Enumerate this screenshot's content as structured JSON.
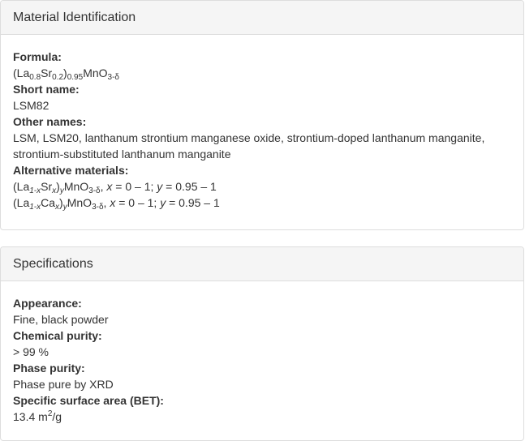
{
  "identification": {
    "heading": "Material Identification",
    "formula_label": "Formula:",
    "formula": {
      "p1": "(La",
      "s1": "0.8",
      "p2": "Sr",
      "s2": "0.2",
      "p3": ")",
      "s3": "0.95",
      "p4": "MnO",
      "s4": "3-δ"
    },
    "short_name_label": "Short name:",
    "short_name": "LSM82",
    "other_names_label": "Other names:",
    "other_names": "LSM, LSM20, lanthanum strontium manganese oxide, strontium-doped lanthanum manganite, strontium-substituted lanthanum manganite",
    "alternatives_label": "Alternative materials:",
    "alt1": {
      "p1": "(La",
      "s1": "1-x",
      "p2": "Sr",
      "s2": "x",
      "p3": ")",
      "s3": "y",
      "p4": "MnO",
      "s4": "3-δ",
      "tail_a": ", ",
      "xvar": "x",
      "tail_b": " = 0 – 1; ",
      "yvar": "y",
      "tail_c": " = 0.95 – 1"
    },
    "alt2": {
      "p1": "(La",
      "s1": "1-x",
      "p2": "Ca",
      "s2": "x",
      "p3": ")",
      "s3": "y",
      "p4": "MnO",
      "s4": "3-δ",
      "tail_a": ", ",
      "xvar": "x",
      "tail_b": " = 0 – 1; ",
      "yvar": "y",
      "tail_c": " = 0.95 – 1"
    }
  },
  "specifications": {
    "heading": "Specifications",
    "appearance_label": "Appearance:",
    "appearance": "Fine, black powder",
    "chemical_purity_label": "Chemical purity:",
    "chemical_purity": "> 99 %",
    "phase_purity_label": "Phase purity:",
    "phase_purity": "Phase pure by XRD",
    "surface_area_label": "Specific surface area (BET):",
    "surface_area_value": "13.4 m",
    "surface_area_sup": "2",
    "surface_area_unit": "/g"
  }
}
